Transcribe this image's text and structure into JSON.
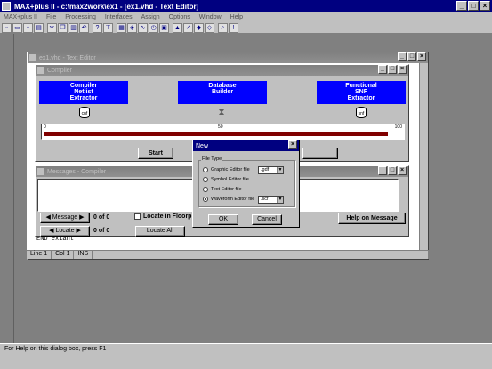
{
  "app": {
    "title": "MAX+plus II - c:\\max2work\\ex1 - [ex1.vhd - Text Editor]"
  },
  "menu": [
    "MAX+plus II",
    "File",
    "Processing",
    "Interfaces",
    "Assign",
    "Options",
    "Window",
    "Help"
  ],
  "toolbar_icons": [
    "new-icon",
    "open-icon",
    "save-icon",
    "print-icon",
    "cut-icon",
    "copy-icon",
    "paste-icon",
    "undo-icon",
    "help-icon",
    "hierarchy-icon",
    "floorplan-icon",
    "compiler-icon",
    "simulator-icon",
    "timing-icon",
    "programmer-icon",
    "project-icon",
    "save-check-icon",
    "save-compile-icon",
    "save-simulate-icon",
    "find-icon",
    "warning-icon"
  ],
  "editor": {
    "title": "ex1.vhd - Text Editor"
  },
  "compiler": {
    "title": "Compiler",
    "modules": [
      {
        "lines": [
          "Compiler",
          "Netlist",
          "Extractor"
        ],
        "file_ext": "cnf"
      },
      {
        "lines": [
          "Database",
          "Builder"
        ],
        "file_ext": ""
      },
      {
        "lines": [
          "Functional",
          "SNF",
          "Extractor"
        ],
        "file_ext": "snf"
      }
    ],
    "progress_min": "0",
    "progress_mid": "50",
    "progress_max": "100",
    "progress_value": 0.96,
    "start_label": "Start"
  },
  "messages": {
    "title": "Messages - Compiler",
    "message_label": "Message",
    "message_count": "0 of 0",
    "locate_label": "Locate",
    "locate_count": "0 of 0",
    "locate_in_floorplan": "Locate in Floorplan",
    "locate_all": "Locate All",
    "help_on_message": "Help on Message"
  },
  "editor_status": {
    "line_label": "Line",
    "line": "1",
    "col_label": "Col",
    "col": "1",
    "mode": "INS"
  },
  "editor_text": "END ex1ant",
  "dialog": {
    "title": "New",
    "group_label": "File Type",
    "options": [
      {
        "label": "Graphic Editor file",
        "selected": false,
        "ext": ".gdf"
      },
      {
        "label": "Symbol Editor file",
        "selected": false,
        "ext": ""
      },
      {
        "label": "Text Editor file",
        "selected": false,
        "ext": ""
      },
      {
        "label": "Waveform Editor file",
        "selected": true,
        "ext": ".scf"
      }
    ],
    "ok_label": "OK",
    "cancel_label": "Cancel"
  },
  "statusbar": {
    "text": "For Help on this dialog box, press F1"
  }
}
